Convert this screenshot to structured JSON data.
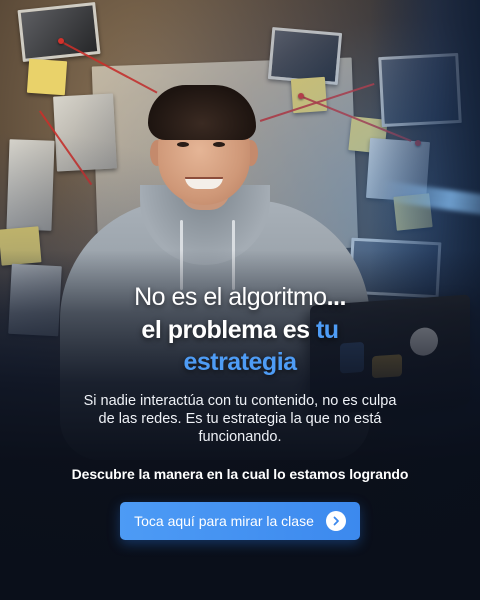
{
  "headline": {
    "line1_text": "No es el algoritmo",
    "line1_dots": "...",
    "line2_text": "el problema es ",
    "line2_accent": "tu",
    "line3_accent": "estrategia"
  },
  "body": {
    "text": "Si nadie interactúa con tu contenido, no es culpa de las redes. Es tu estrategia la que no está funcionando."
  },
  "cta": {
    "lead_text": "Descubre la manera en la cual lo estamos logrando",
    "button_label": "Toca aquí para mirar la clase",
    "button_icon": "chevron-right-circle-icon"
  },
  "colors": {
    "accent": "#4e9cf5",
    "button": "#4d9bf5",
    "background": "#0a0f1a"
  }
}
